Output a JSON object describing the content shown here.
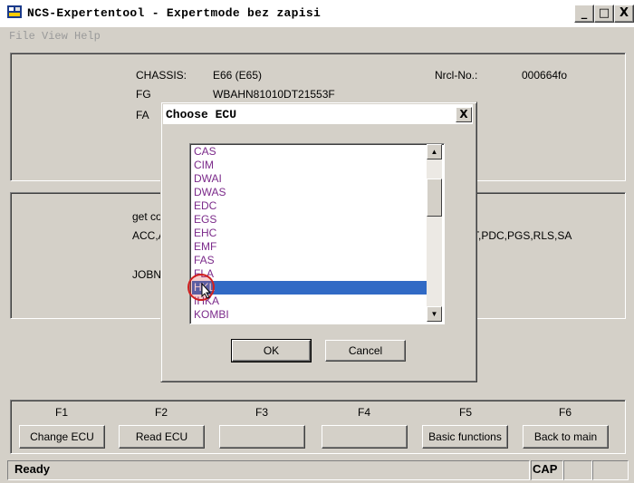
{
  "window": {
    "title": "NCS-Expertentool - Expertmode bez zapisi",
    "minimize_label": "_",
    "maximize_label": "□",
    "close_label": "X"
  },
  "menu": [
    "File",
    "View",
    "Help"
  ],
  "vehicle": {
    "chassis_label": "CHASSIS:",
    "chassis_value": "E66 (E65)",
    "fg_label": "FG",
    "fg_value": "WBAHN81010DT21553F",
    "fa_label": "FA",
    "nrcl_label": "Nrcl-No.:",
    "nrcl_value": "000664fo"
  },
  "coding": {
    "get_label": "get co",
    "acc_label": "ACC,A",
    "acc_tail": "T,PDC,PGS,RLS,SA",
    "jobname_label": "JOBNA"
  },
  "dialog": {
    "title": "Choose ECU",
    "close_label": "X",
    "items": [
      "CAS",
      "CIM",
      "DWAI",
      "DWAS",
      "EDC",
      "EGS",
      "EHC",
      "EMF",
      "FAS",
      "FLA",
      "HKL",
      "IHKA",
      "KOMBI"
    ],
    "selected_index": 10,
    "ok_label": "OK",
    "cancel_label": "Cancel",
    "scroll_up_glyph": "▲",
    "scroll_down_glyph": "▼"
  },
  "function_keys": [
    {
      "key": "F1",
      "label": "Change ECU"
    },
    {
      "key": "F2",
      "label": "Read ECU"
    },
    {
      "key": "F3",
      "label": ""
    },
    {
      "key": "F4",
      "label": ""
    },
    {
      "key": "F5",
      "label": "Basic functions"
    },
    {
      "key": "F6",
      "label": "Back to main"
    }
  ],
  "status": {
    "text": "Ready",
    "cap": "CAP"
  },
  "colors": {
    "selection": "#316ac5",
    "list_text": "#7b2a8a",
    "face": "#d4d0c8"
  }
}
